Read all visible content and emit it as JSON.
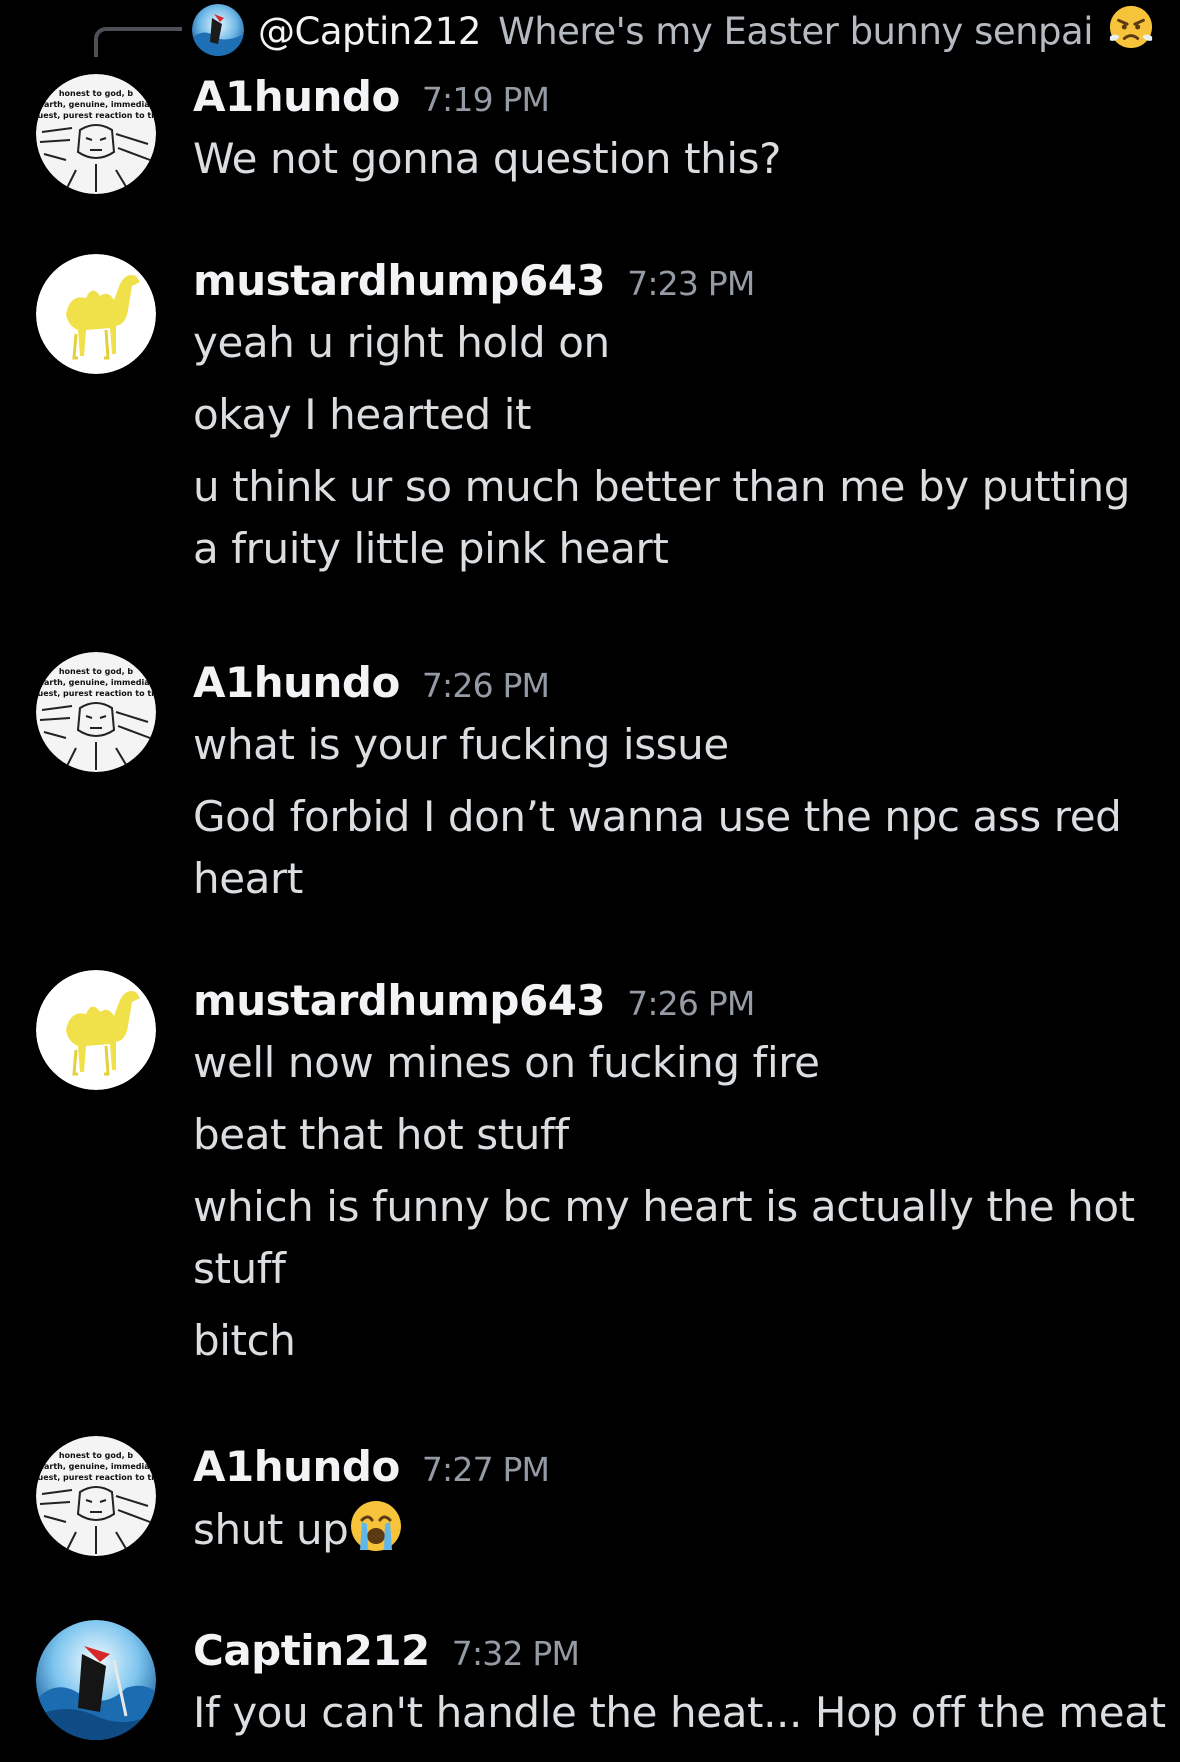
{
  "reply": {
    "author": "@Captin212",
    "content": "Where's my Easter bunny senpai",
    "emoji": "angry-face-emoji"
  },
  "avatar_sketch_text": [
    "honest to god, b",
    "earth, genuine, immediat",
    "truest, purest reaction to tha"
  ],
  "groups": [
    {
      "author": "A1hundo",
      "time": "7:19 PM",
      "avatar": "sketch",
      "messages": [
        "We not gonna question this?"
      ]
    },
    {
      "author": "mustardhump643",
      "time": "7:23 PM",
      "avatar": "camel",
      "messages": [
        "yeah u right hold on",
        "okay I hearted it",
        "u think ur so much better than me by putting a fruity little pink heart"
      ]
    },
    {
      "author": "A1hundo",
      "time": "7:26 PM",
      "avatar": "sketch",
      "messages": [
        "what is your fucking issue",
        "God forbid I don’t wanna use the npc ass red heart"
      ]
    },
    {
      "author": "mustardhump643",
      "time": "7:26 PM",
      "avatar": "camel",
      "messages": [
        "well now mines on fucking fire",
        "beat that hot stuff",
        "which is funny bc my heart is actually the hot stuff",
        "bitch"
      ]
    },
    {
      "author": "A1hundo",
      "time": "7:27 PM",
      "avatar": "sketch",
      "messages": [
        "shut up"
      ],
      "trailing_emoji": "crying-face-emoji"
    },
    {
      "author": "Captin212",
      "time": "7:32 PM",
      "avatar": "wave",
      "messages": [
        "If you can't handle the heat... Hop off the meat"
      ]
    }
  ],
  "colors": {
    "background": "#000000",
    "author": "#f2f3f5",
    "timestamp": "#949ba4",
    "message": "#dbdee1",
    "reply_text": "#b5bac1"
  }
}
